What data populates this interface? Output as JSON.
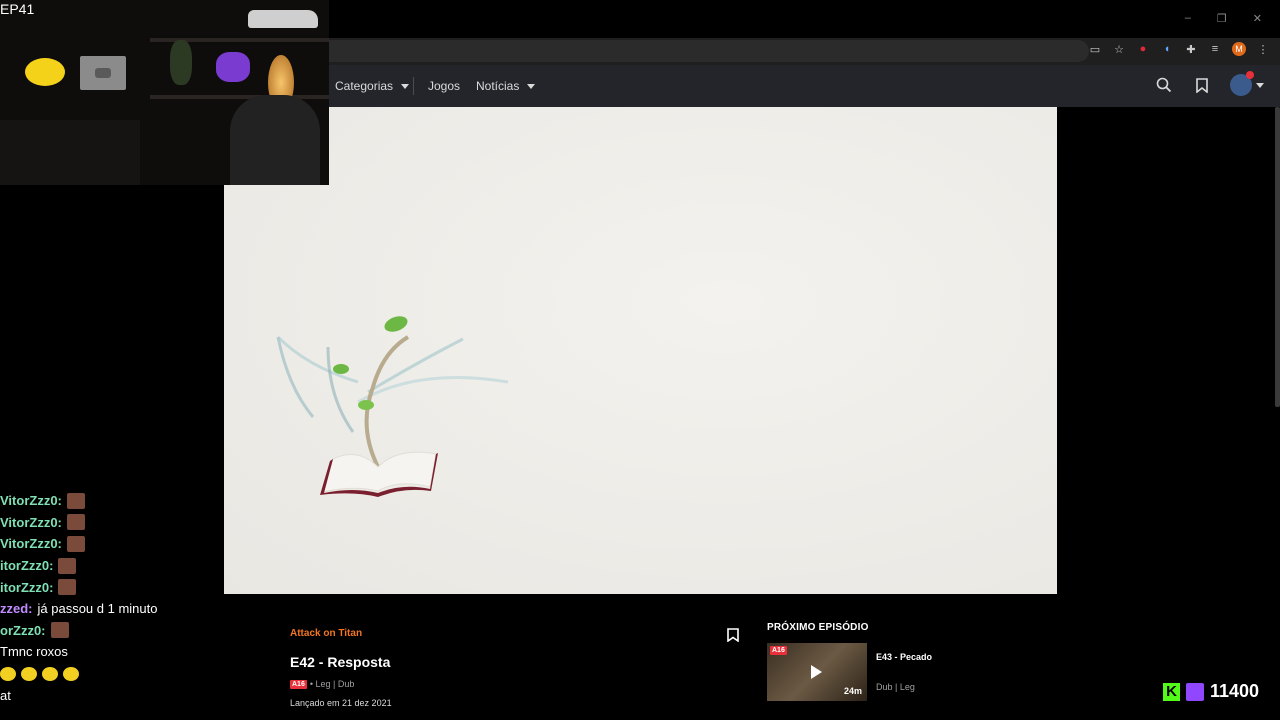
{
  "browser": {
    "window_controls": [
      "–",
      "❐",
      "✕"
    ],
    "extension_icons": [
      "cast-icon",
      "star-icon",
      "shield-icon",
      "audio-icon",
      "puzzle-icon",
      "media-icon",
      "profile-m-icon",
      "more-icon"
    ],
    "profile_initial": "M"
  },
  "nav": {
    "items": [
      {
        "label": "Categorias",
        "has_dropdown": true
      },
      {
        "label": "Jogos",
        "has_dropdown": false
      },
      {
        "label": "Notícias",
        "has_dropdown": true
      }
    ]
  },
  "webcam": {
    "label": "EP41"
  },
  "chat": {
    "lines": [
      {
        "name": "VitorZzz0:",
        "message": "",
        "name_color": "green",
        "emotes": 1
      },
      {
        "name": "VitorZzz0:",
        "message": "",
        "name_color": "green",
        "emotes": 1
      },
      {
        "name": "VitorZzz0:",
        "message": "",
        "name_color": "green",
        "emotes": 1
      },
      {
        "name": "itorZzz0:",
        "message": "",
        "name_color": "green",
        "emotes": 1
      },
      {
        "name": "itorZzz0:",
        "message": "",
        "name_color": "green",
        "emotes": 1
      },
      {
        "name": "zzed:",
        "message": "já passou d 1 minuto",
        "name_color": "purple",
        "emotes": 0
      },
      {
        "name": "orZzz0:",
        "message": "",
        "name_color": "green",
        "emotes": 1
      },
      {
        "name": "",
        "message": "Tmnc roxos",
        "name_color": "none",
        "emotes": 0
      },
      {
        "name": "",
        "message": "",
        "name_color": "none",
        "emotes": 4,
        "emote_color": "yellow"
      },
      {
        "name": "",
        "message": "at",
        "name_color": "none",
        "emotes": 0
      }
    ]
  },
  "episode": {
    "series": "Attack on Titan",
    "title": "E42 - Resposta",
    "rating": "A16",
    "languages": "• Leg | Dub",
    "release": "Lançado em 21 dez 2021"
  },
  "next_episode": {
    "heading": "PRÓXIMO EPISÓDIO",
    "title": "E43 - Pecado",
    "rating": "A16",
    "duration": "24m",
    "languages": "Dub | Leg"
  },
  "stream": {
    "k_label": "K",
    "viewers": "11400"
  },
  "colors": {
    "accent": "#f47521",
    "nav_bg": "#23252b",
    "player_bg": "#efede8",
    "kick_green": "#53fc18",
    "twitch_purple": "#9146ff"
  }
}
